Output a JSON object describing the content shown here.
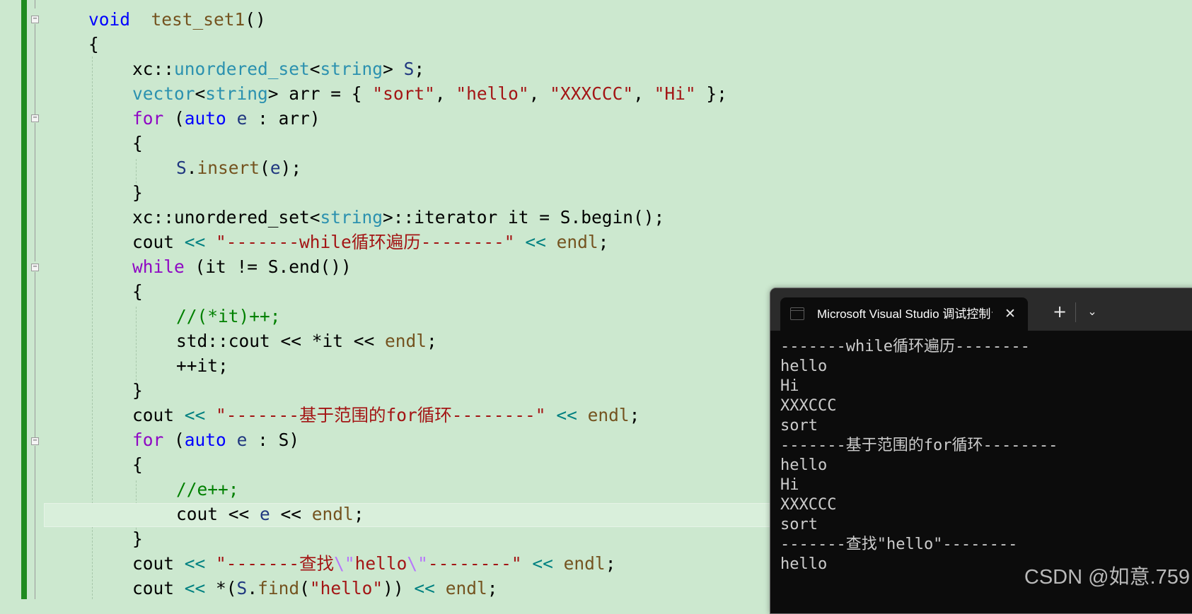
{
  "editor": {
    "lines": [
      {
        "parts": [
          [
            "kw",
            "void"
          ],
          [
            "",
            "  "
          ],
          [
            "fn",
            "test_set1"
          ],
          [
            "",
            "()"
          ]
        ]
      },
      {
        "parts": [
          [
            "",
            "{"
          ]
        ]
      },
      {
        "parts": [
          [
            "",
            "xc::"
          ],
          [
            "ty",
            "unordered_set"
          ],
          [
            "",
            "<"
          ],
          [
            "ty",
            "string"
          ],
          [
            "",
            "> "
          ],
          [
            "var",
            "S"
          ],
          [
            "",
            ";"
          ]
        ]
      },
      {
        "parts": [
          [
            "ty",
            "vector"
          ],
          [
            "",
            "<"
          ],
          [
            "ty",
            "string"
          ],
          [
            "",
            "> arr = { "
          ],
          [
            "st",
            "\"sort\""
          ],
          [
            "",
            ", "
          ],
          [
            "st",
            "\"hello\""
          ],
          [
            "",
            ", "
          ],
          [
            "st",
            "\"XXXCCC\""
          ],
          [
            "",
            ", "
          ],
          [
            "st",
            "\"Hi\""
          ],
          [
            "",
            " };"
          ]
        ]
      },
      {
        "parts": [
          [
            "ctl",
            "for"
          ],
          [
            "",
            " ("
          ],
          [
            "kw",
            "auto"
          ],
          [
            "",
            " "
          ],
          [
            "var",
            "e"
          ],
          [
            "",
            " : arr)"
          ]
        ]
      },
      {
        "parts": [
          [
            "",
            "{"
          ]
        ]
      },
      {
        "parts": [
          [
            "var",
            "S"
          ],
          [
            "",
            "."
          ],
          [
            "fn",
            "insert"
          ],
          [
            "",
            "("
          ],
          [
            "var",
            "e"
          ],
          [
            "",
            ");"
          ]
        ]
      },
      {
        "parts": [
          [
            "",
            "}"
          ]
        ]
      },
      {
        "parts": [
          [
            "",
            "xc::unordered_set<"
          ],
          [
            "ty",
            "string"
          ],
          [
            "",
            ">::iterator it = S.begin();"
          ]
        ]
      },
      {
        "parts": [
          [
            "",
            "cout "
          ],
          [
            "op",
            "<<"
          ],
          [
            "",
            " "
          ],
          [
            "st",
            "\"-------while循环遍历--------\""
          ],
          [
            "",
            " "
          ],
          [
            "op",
            "<<"
          ],
          [
            "",
            " "
          ],
          [
            "fn",
            "endl"
          ],
          [
            "",
            ";"
          ]
        ]
      },
      {
        "parts": [
          [
            "ctl",
            "while"
          ],
          [
            "",
            " (it != S.end())"
          ]
        ]
      },
      {
        "parts": [
          [
            "",
            "{"
          ]
        ]
      },
      {
        "parts": [
          [
            "cm",
            "//(*it)++;"
          ]
        ]
      },
      {
        "parts": [
          [
            "",
            "std::cout << *it << "
          ],
          [
            "fn",
            "endl"
          ],
          [
            "",
            ";"
          ]
        ]
      },
      {
        "parts": [
          [
            "",
            "++it;"
          ]
        ]
      },
      {
        "parts": [
          [
            "",
            "}"
          ]
        ]
      },
      {
        "parts": [
          [
            "",
            "cout "
          ],
          [
            "op",
            "<<"
          ],
          [
            "",
            " "
          ],
          [
            "st",
            "\"-------基于范围的for循环--------\""
          ],
          [
            "",
            " "
          ],
          [
            "op",
            "<<"
          ],
          [
            "",
            " "
          ],
          [
            "fn",
            "endl"
          ],
          [
            "",
            ";"
          ]
        ]
      },
      {
        "parts": [
          [
            "ctl",
            "for"
          ],
          [
            "",
            " ("
          ],
          [
            "kw",
            "auto"
          ],
          [
            "",
            " "
          ],
          [
            "var",
            "e"
          ],
          [
            "",
            " : S)"
          ]
        ]
      },
      {
        "parts": [
          [
            "",
            "{"
          ]
        ]
      },
      {
        "parts": [
          [
            "cm",
            "//e++;"
          ]
        ]
      },
      {
        "parts": [
          [
            "",
            "cout << "
          ],
          [
            "var",
            "e"
          ],
          [
            "",
            " << "
          ],
          [
            "fn",
            "endl"
          ],
          [
            "",
            ";"
          ]
        ]
      },
      {
        "parts": [
          [
            "",
            "}"
          ]
        ]
      },
      {
        "parts": [
          [
            "",
            "cout "
          ],
          [
            "op",
            "<<"
          ],
          [
            "",
            " "
          ],
          [
            "st",
            "\"-------查找"
          ],
          [
            "esc",
            "\\\""
          ],
          [
            "st",
            "hello"
          ],
          [
            "esc",
            "\\\""
          ],
          [
            "st",
            "--------\""
          ],
          [
            "",
            " "
          ],
          [
            "op",
            "<<"
          ],
          [
            "",
            " "
          ],
          [
            "fn",
            "endl"
          ],
          [
            "",
            ";"
          ]
        ]
      },
      {
        "parts": [
          [
            "",
            "cout "
          ],
          [
            "op",
            "<<"
          ],
          [
            "",
            " *("
          ],
          [
            "var",
            "S"
          ],
          [
            "",
            "."
          ],
          [
            "fn",
            "find"
          ],
          [
            "",
            "("
          ],
          [
            "st",
            "\"hello\""
          ],
          [
            "",
            "))"
          ],
          [
            " ",
            " "
          ],
          [
            "op",
            "<<"
          ],
          [
            "",
            " "
          ],
          [
            "fn",
            "endl"
          ],
          [
            "",
            ";"
          ]
        ]
      }
    ]
  },
  "console": {
    "tab_title": "Microsoft Visual Studio 调试控制台",
    "close_glyph": "✕",
    "new_tab_glyph": "+",
    "dropdown_glyph": "⌄",
    "output_lines": [
      "-------while循环遍历--------",
      "hello",
      "Hi",
      "XXXCCC",
      "sort",
      "-------基于范围的for循环--------",
      "hello",
      "Hi",
      "XXXCCC",
      "sort",
      "-------查找\"hello\"--------",
      "hello"
    ]
  },
  "watermark": "CSDN @如意.759"
}
